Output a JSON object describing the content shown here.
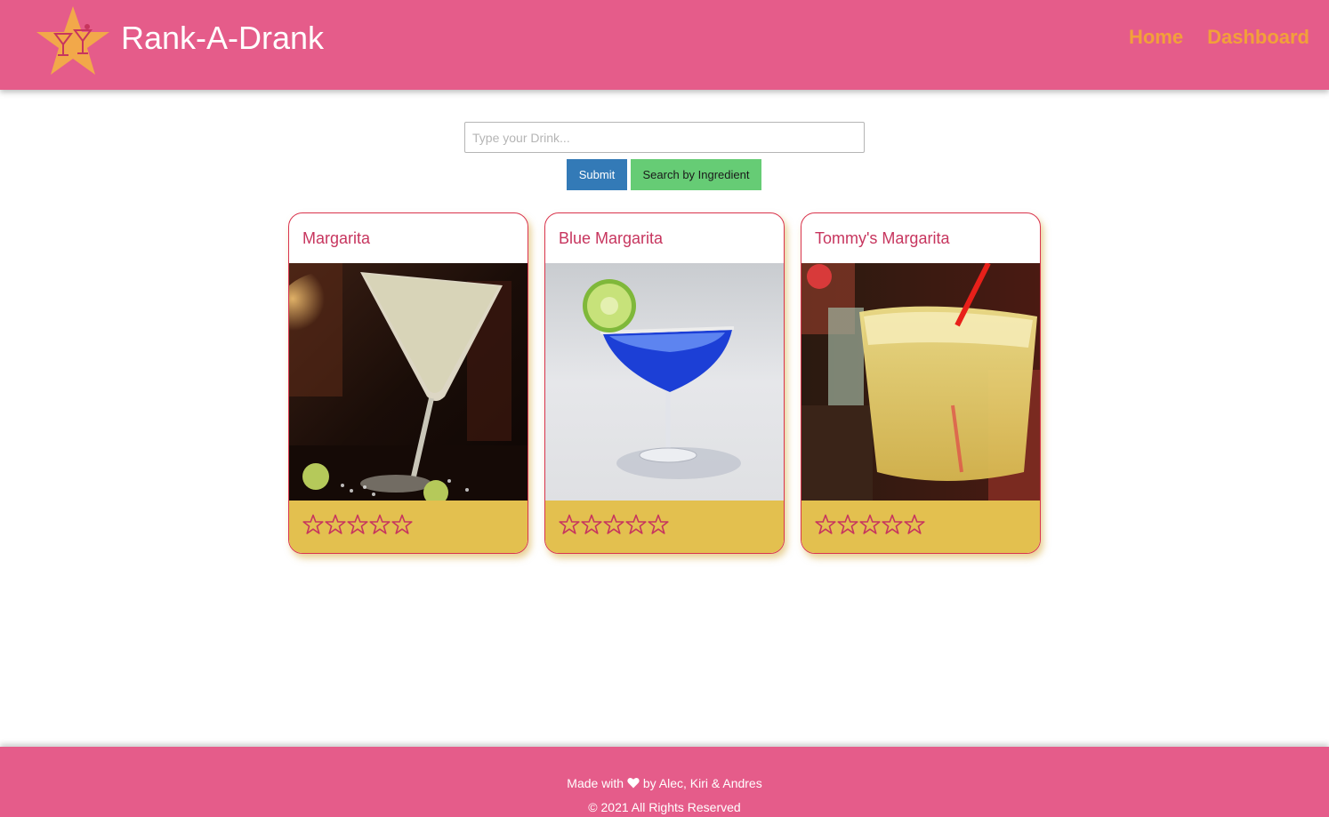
{
  "header": {
    "title": "Rank-A-Drank",
    "logo_icon": "star-cocktail-logo-icon",
    "nav": [
      {
        "label": "Home"
      },
      {
        "label": "Dashboard"
      }
    ]
  },
  "search": {
    "placeholder": "Type your Drink...",
    "value": "",
    "submit_label": "Submit",
    "ingredient_label": "Search by Ingredient"
  },
  "cards": [
    {
      "title": "Margarita",
      "image": "margarita-photo",
      "rating": 0,
      "max_rating": 5
    },
    {
      "title": "Blue Margarita",
      "image": "blue-margarita-photo",
      "rating": 0,
      "max_rating": 5
    },
    {
      "title": "Tommy's Margarita",
      "image": "tommys-margarita-photo",
      "rating": 0,
      "max_rating": 5
    }
  ],
  "footer": {
    "made_prefix": "Made with",
    "made_suffix": "by Alec, Kiri & Andres",
    "copyright": "© 2021 All Rights Reserved",
    "heart_icon": "heart-icon"
  },
  "colors": {
    "header_bg": "#e55c8a",
    "nav_link": "#f2a03a",
    "card_title": "#c7355e",
    "card_footer": "#e3c04f",
    "submit_btn": "#337ab7",
    "ingredient_btn": "#66cc75"
  }
}
